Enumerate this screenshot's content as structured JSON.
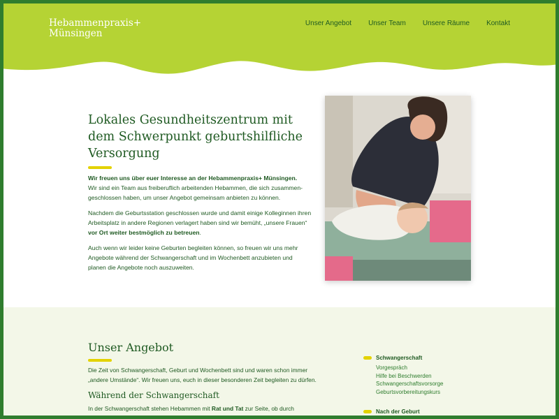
{
  "header": {
    "logo_line1": "Hebammenpraxis+",
    "logo_line2": "Münsingen",
    "nav": [
      "Unser Angebot",
      "Unser Team",
      "Unsere Räume",
      "Kontakt"
    ],
    "bg_color": "#b5d334"
  },
  "hero": {
    "title": "Lokales Gesundheitszentrum mit dem Schwerpunkt geburtshilfliche Versorgung",
    "p1_bold": "Wir freuen uns über euer Interesse an der Hebammenpraxis+ Münsingen.",
    "p1_rest": "Wir sind ein Team aus freiberuflich arbeitenden Hebammen, die sich zusammen­geschlossen haben, um unser Angebot gemeinsam anbieten zu können.",
    "p2_start": "Nachdem die Geburtsstation geschlossen wurde und damit einige Kolleginnen ihren Arbeitsplatz in andere Regionen verlagert haben sind wir bemüht, „unsere Frauen“",
    "p2_bold": " vor Ort weiter bestmöglich zu betreuen",
    "p2_end": ".",
    "p3": "Auch wenn wir leider keine Geburten begleiten können, so freuen wir uns mehr Angebote während der Schwangerschaft und im Wochenbett anzubieten und planen die Angebote noch auszuweiten."
  },
  "offer": {
    "title": "Unser Angebot",
    "intro": "Die Zeit von Schwangerschaft, Geburt und Wochenbett sind und waren schon immer „andere Umstände“. Wir freuen uns, euch in dieser besonderen Zeit begleiten zu dürfen.",
    "subtitle": "Während der Schwangerschaft",
    "text_start": "In der Schwangerschaft stehen Hebammen mit ",
    "text_bold": "Rat und Tat",
    "text_end": " zur Seite, ob durch",
    "side": [
      {
        "label": "Schwangerschaft",
        "items": [
          "Vorgespräch",
          "Hilfe bei Beschwerden",
          "Schwangerschaftsvorsorge",
          "Geburtsvorbereitungskurs"
        ]
      },
      {
        "label": "Nach der Geburt",
        "items": []
      }
    ]
  }
}
